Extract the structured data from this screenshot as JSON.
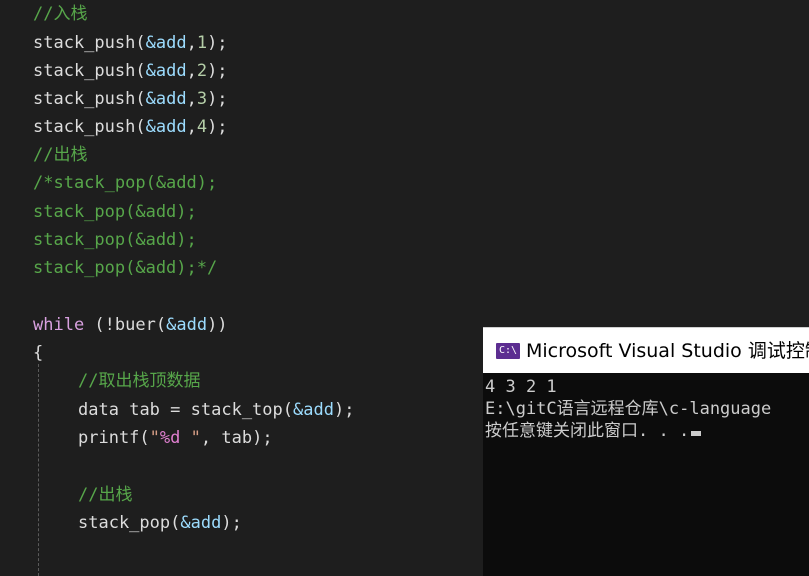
{
  "editor": {
    "comment_push": "//入栈",
    "push_calls": [
      {
        "fn": "stack_push",
        "arg_var": "&add",
        "arg_num": "1"
      },
      {
        "fn": "stack_push",
        "arg_var": "&add",
        "arg_num": "2"
      },
      {
        "fn": "stack_push",
        "arg_var": "&add",
        "arg_num": "3"
      },
      {
        "fn": "stack_push",
        "arg_var": "&add",
        "arg_num": "4"
      }
    ],
    "comment_pop": "//出栈",
    "block_comment": [
      "/*stack_pop(&add);",
      "stack_pop(&add);",
      "stack_pop(&add);",
      "stack_pop(&add);*/"
    ],
    "while_kw": "while",
    "while_fn": "buer",
    "while_arg": "&add",
    "brace_open": "{",
    "comment_get_top": "//取出栈顶数据",
    "decl_type": "data",
    "decl_var": "tab",
    "decl_fn": "stack_top",
    "decl_arg": "&add",
    "printf_fn": "printf",
    "printf_fmt_spec": "%d",
    "printf_arg": "tab",
    "comment_pop_inner": "//出栈",
    "pop_fn": "stack_pop",
    "pop_arg": "&add"
  },
  "console": {
    "icon_label": "C:\\",
    "title": "Microsoft Visual Studio 调试控制台",
    "lines": [
      "4 3 2 1",
      "E:\\gitC语言远程仓库\\c-language",
      "按任意键关闭此窗口. . ."
    ]
  },
  "colors": {
    "background": "#1e1e1e",
    "comment": "#57a64a",
    "variable": "#9cdcfe",
    "keyword": "#d8a0df",
    "string": "#d69d85",
    "console_bg": "#0c0c0c",
    "console_icon": "#5c2d91"
  }
}
